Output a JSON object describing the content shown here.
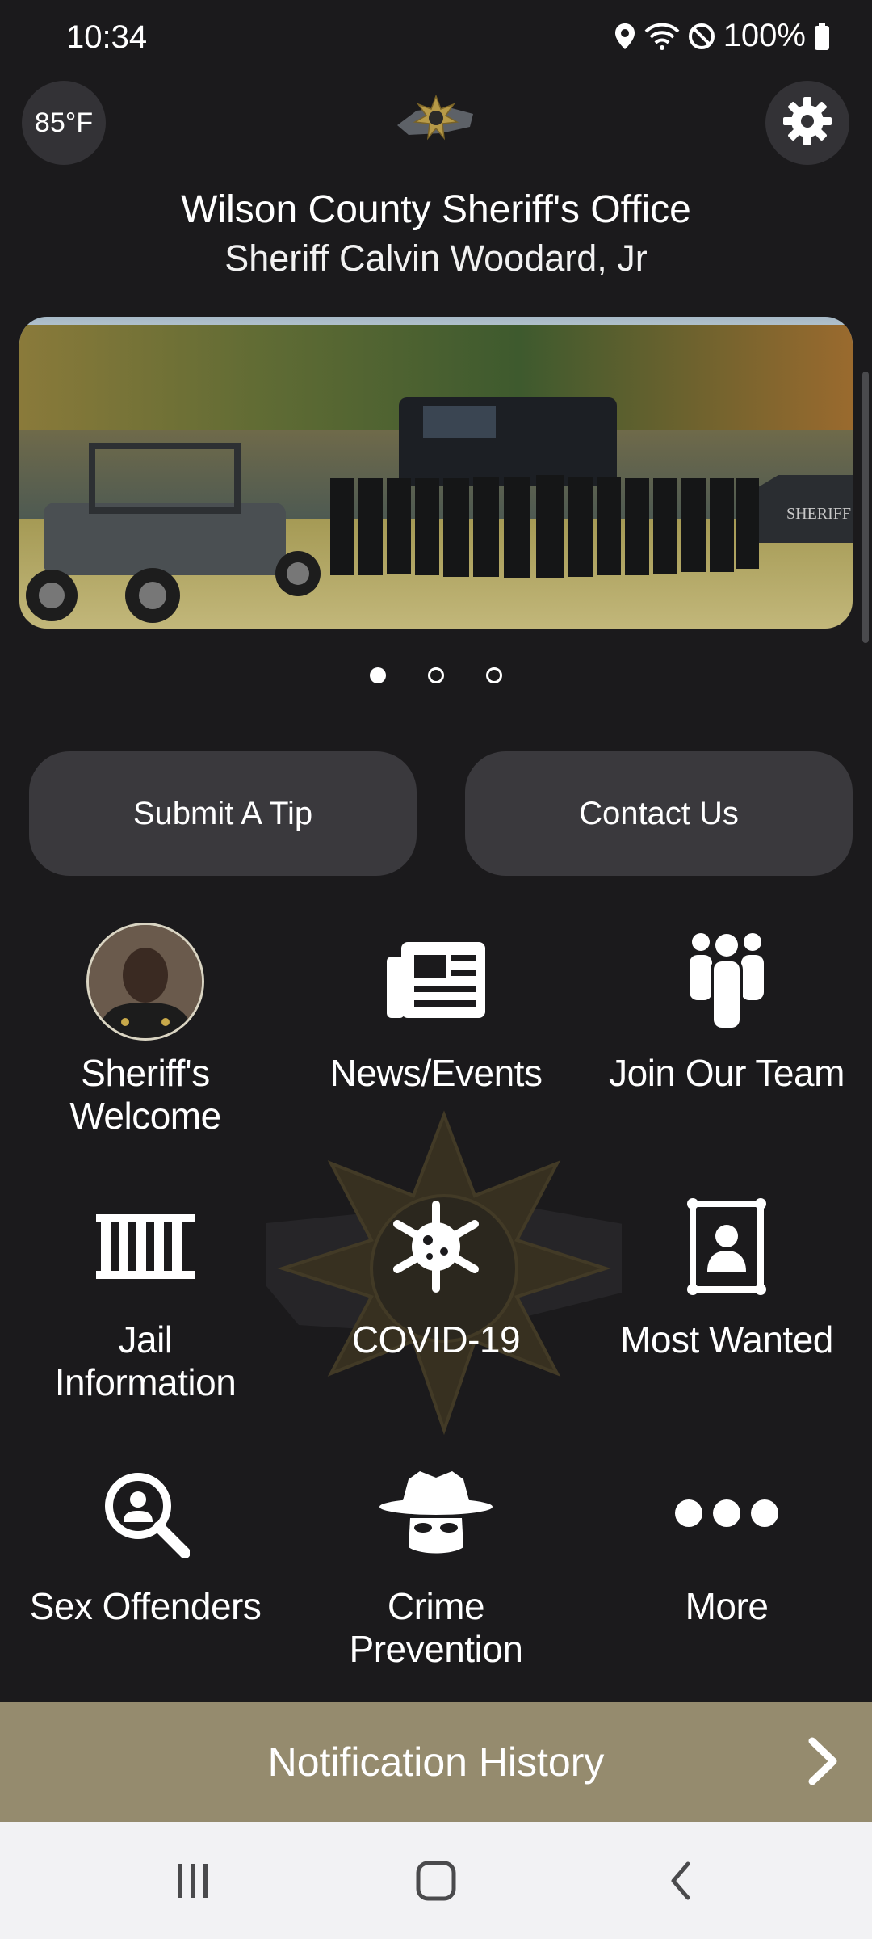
{
  "status_bar": {
    "time": "10:34",
    "battery": "100%",
    "icons": [
      "location-icon",
      "wifi-icon",
      "do-not-disturb-icon",
      "battery-icon"
    ]
  },
  "header": {
    "temperature": "85°F",
    "title": "Wilson County Sheriff's Office",
    "subtitle": "Sheriff Calvin Woodard, Jr",
    "settings_icon": "gear-icon"
  },
  "carousel": {
    "slide_count": 3,
    "active_index": 0
  },
  "actions": {
    "submit_tip": "Submit A Tip",
    "contact_us": "Contact Us"
  },
  "grid": {
    "sheriffs_welcome": {
      "line1": "Sheriff's",
      "line2": "Welcome"
    },
    "news_events": "News/Events",
    "join_team": "Join Our Team",
    "jail_info": {
      "line1": "Jail",
      "line2": "Information"
    },
    "covid": "COVID-19",
    "most_wanted": "Most Wanted",
    "sex_offenders": "Sex Offenders",
    "crime_prevention": {
      "line1": "Crime",
      "line2": "Prevention"
    },
    "more": "More"
  },
  "notification": {
    "label": "Notification History"
  },
  "colors": {
    "background": "#1b1a1c",
    "button": "#3a393d",
    "notification_bar": "#958b6e",
    "nav_bar": "#f2f2f4"
  }
}
